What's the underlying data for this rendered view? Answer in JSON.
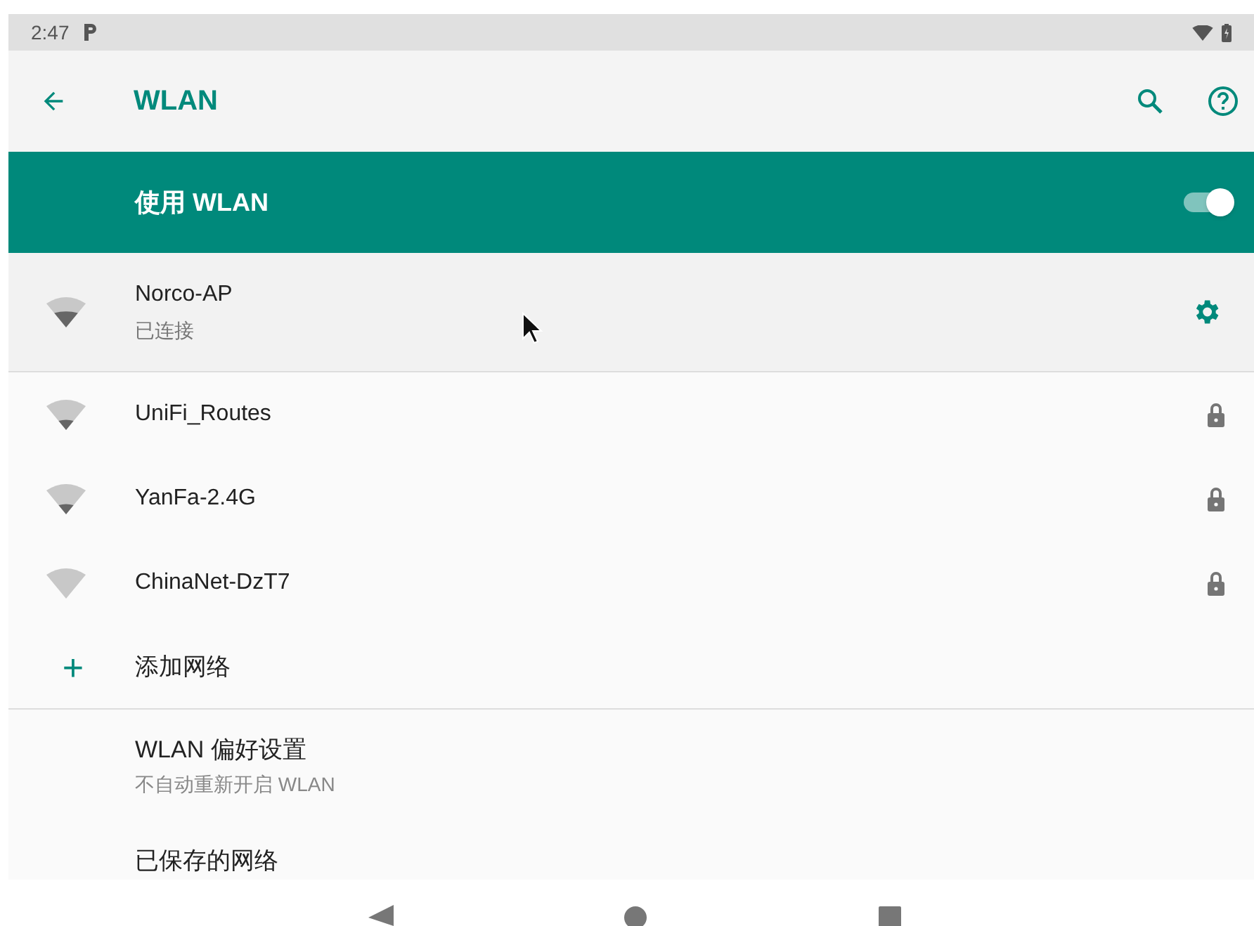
{
  "status_bar": {
    "time": "2:47"
  },
  "toolbar": {
    "title": "WLAN"
  },
  "master_switch": {
    "label": "使用 WLAN",
    "on": true
  },
  "networks": [
    {
      "name": "Norco-AP",
      "status": "已连接",
      "connected": true,
      "kind": "medium"
    },
    {
      "name": "UniFi_Routes",
      "connected": false,
      "kind": "low",
      "secured": true
    },
    {
      "name": "YanFa-2.4G",
      "connected": false,
      "kind": "low",
      "secured": true
    },
    {
      "name": "ChinaNet-DzT7",
      "connected": false,
      "kind": "none",
      "secured": true
    }
  ],
  "add_network": {
    "icon": "+",
    "label": "添加网络"
  },
  "preferences": [
    {
      "title": "WLAN 偏好设置",
      "summary": "不自动重新开启 WLAN"
    },
    {
      "title": "已保存的网络"
    }
  ]
}
